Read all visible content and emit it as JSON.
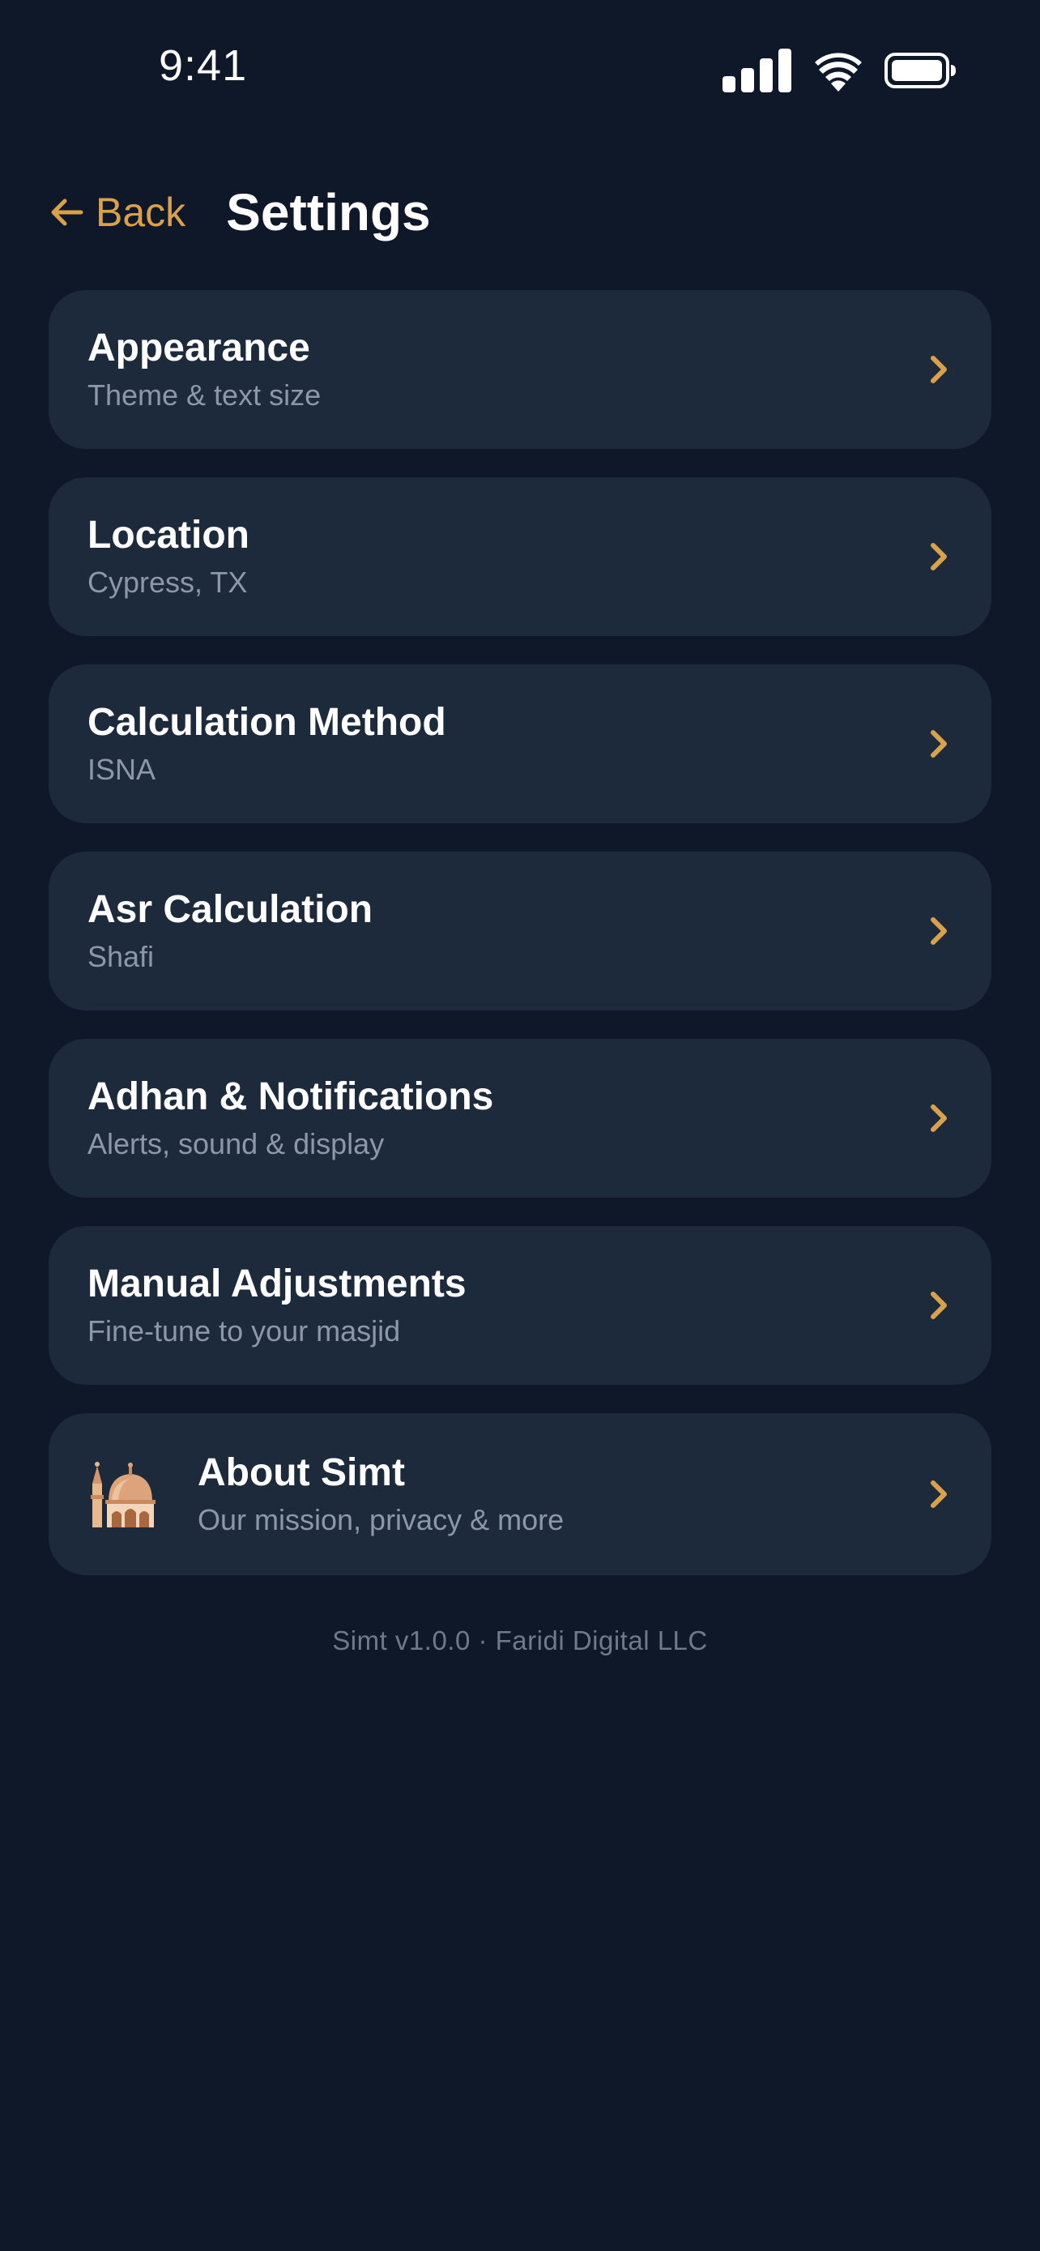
{
  "status_bar": {
    "time": "9:41",
    "icons": [
      "signal-icon",
      "wifi-icon",
      "battery-icon"
    ]
  },
  "header": {
    "back_label": "Back",
    "title": "Settings"
  },
  "colors": {
    "background": "#0E1828",
    "card": "#1C2A3C",
    "accent": "#D9A24A",
    "subtitle": "#8C98A8"
  },
  "settings": [
    {
      "title": "Appearance",
      "subtitle": "Theme & text size"
    },
    {
      "title": "Location",
      "subtitle": "Cypress, TX"
    },
    {
      "title": "Calculation Method",
      "subtitle": "ISNA"
    },
    {
      "title": "Asr Calculation",
      "subtitle": "Shafi"
    },
    {
      "title": "Adhan & Notifications",
      "subtitle": "Alerts, sound & display"
    },
    {
      "title": "Manual Adjustments",
      "subtitle": "Fine-tune to your masjid"
    },
    {
      "title": "About Simt",
      "subtitle": "Our mission, privacy & more",
      "icon": "mosque-icon"
    }
  ],
  "footer": "Simt v1.0.0 · Faridi Digital LLC"
}
